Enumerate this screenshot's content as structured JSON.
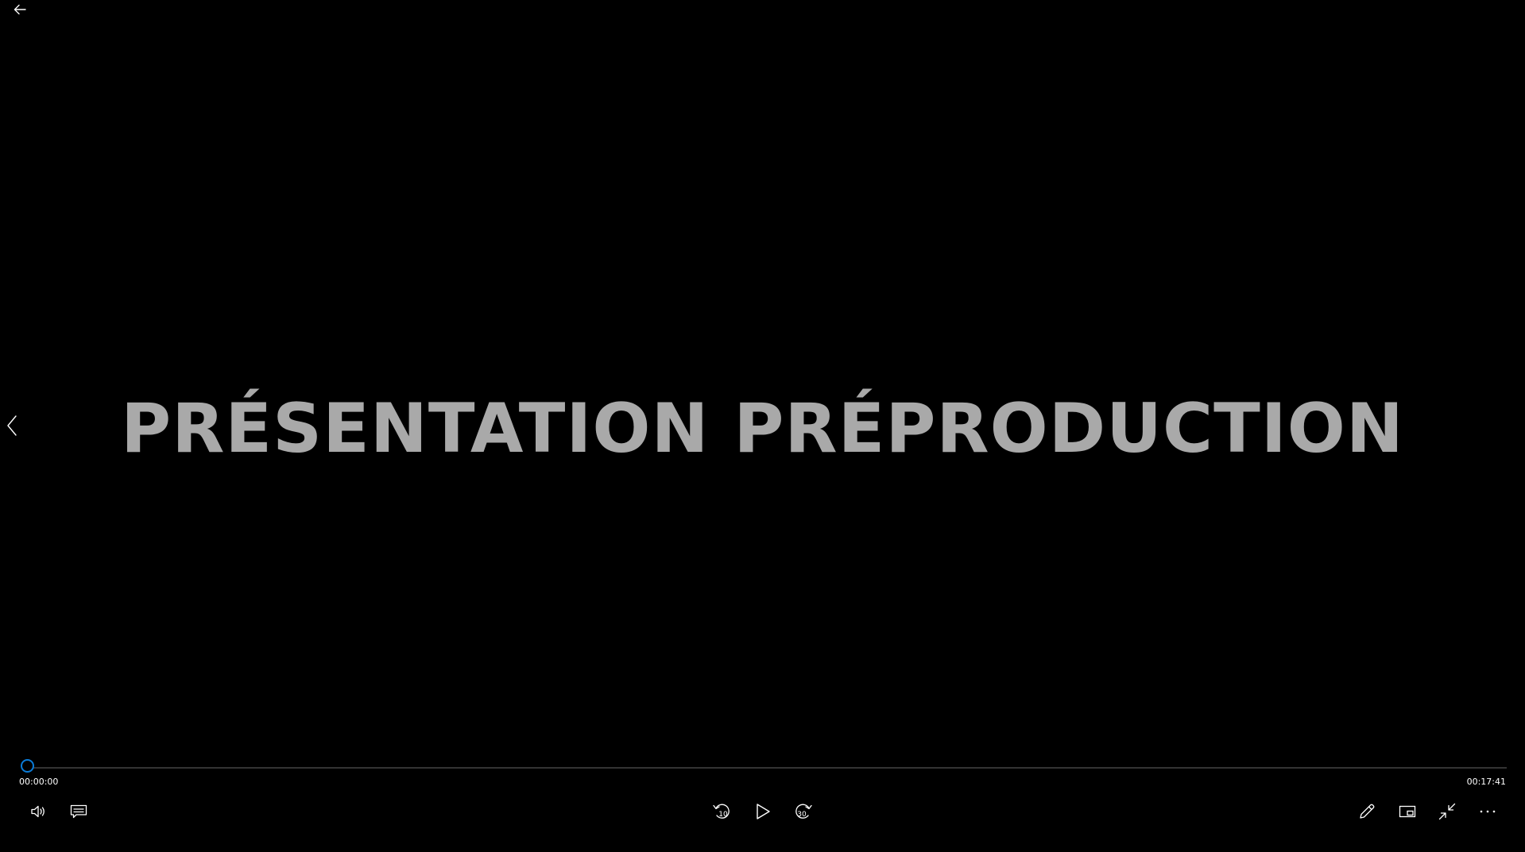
{
  "video": {
    "title": "PRÉSENTATION PRÉPRODUCTION"
  },
  "playback": {
    "current_time": "00:00:00",
    "total_time": "00:17:41",
    "progress": 0.0
  },
  "controls": {
    "skip_back_seconds": "10",
    "skip_forward_seconds": "30"
  },
  "colors": {
    "background": "#000000",
    "accent": "#0a7bd7",
    "title_text": "#a9a9a9",
    "icon": "#ffffff",
    "track": "#333333"
  },
  "icons": {
    "back": "arrow-left-icon",
    "previous": "chevron-left-icon",
    "volume": "volume-icon",
    "captions": "captions-icon",
    "skip_back": "skip-back-10-icon",
    "play": "play-icon",
    "skip_forward": "skip-forward-30-icon",
    "edit": "pencil-icon",
    "mini_view": "mini-view-icon",
    "exit_fullscreen": "exit-fullscreen-icon",
    "more": "more-icon"
  }
}
